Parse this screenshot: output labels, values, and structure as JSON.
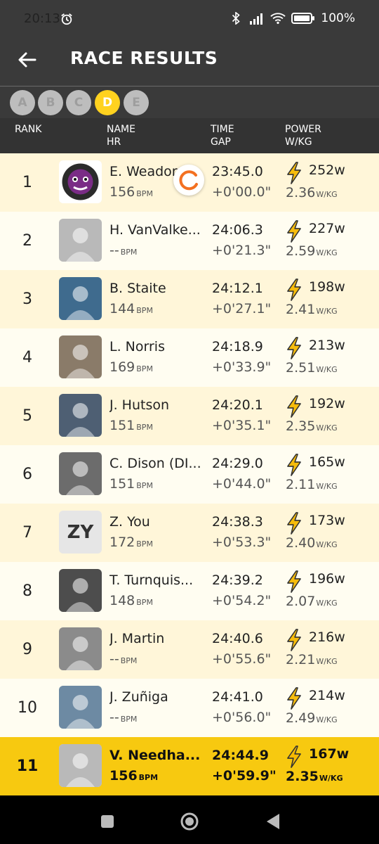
{
  "status": {
    "time": "20:13",
    "battery": "100%"
  },
  "header": {
    "title": "RACE RESULTS"
  },
  "categories": [
    {
      "label": "A",
      "active": false
    },
    {
      "label": "B",
      "active": false
    },
    {
      "label": "C",
      "active": false
    },
    {
      "label": "D",
      "active": true
    },
    {
      "label": "E",
      "active": false
    }
  ],
  "columns": {
    "rank": "RANK",
    "name": "NAME",
    "hr": "HR",
    "time": "TIME",
    "gap": "GAP",
    "power": "POWER",
    "wkg": "W/KG"
  },
  "units": {
    "bpm": "BPM",
    "w": "w",
    "wkg": "W/KG"
  },
  "colors": {
    "accent": "#ffd21f",
    "highlight_row": "#f7c910",
    "bolt": "#f5b800",
    "spinner": "#f37021"
  },
  "results": [
    {
      "rank": "1",
      "name": "E. Weador",
      "hr": "156",
      "time": "23:45.0",
      "gap": "+0'00.0\"",
      "watts": "252",
      "wkg": "2.36",
      "avatar": "gorilla-logo"
    },
    {
      "rank": "2",
      "name": "H. VanValke...",
      "hr": "--",
      "time": "24:06.3",
      "gap": "+0'21.3\"",
      "watts": "227",
      "wkg": "2.59",
      "avatar": "photo"
    },
    {
      "rank": "3",
      "name": "B. Staite",
      "hr": "144",
      "time": "24:12.1",
      "gap": "+0'27.1\"",
      "watts": "198",
      "wkg": "2.41",
      "avatar": "photo"
    },
    {
      "rank": "4",
      "name": "L. Norris",
      "hr": "169",
      "time": "24:18.9",
      "gap": "+0'33.9\"",
      "watts": "213",
      "wkg": "2.51",
      "avatar": "photo"
    },
    {
      "rank": "5",
      "name": "J. Hutson",
      "hr": "151",
      "time": "24:20.1",
      "gap": "+0'35.1\"",
      "watts": "192",
      "wkg": "2.35",
      "avatar": "photo"
    },
    {
      "rank": "6",
      "name": "C. Dison (DI...",
      "hr": "151",
      "time": "24:29.0",
      "gap": "+0'44.0\"",
      "watts": "165",
      "wkg": "2.11",
      "avatar": "photo"
    },
    {
      "rank": "7",
      "name": "Z. You",
      "hr": "172",
      "time": "24:38.3",
      "gap": "+0'53.3\"",
      "watts": "173",
      "wkg": "2.40",
      "avatar": "initials",
      "initials": "ZY"
    },
    {
      "rank": "8",
      "name": "T. Turnquis...",
      "hr": "148",
      "time": "24:39.2",
      "gap": "+0'54.2\"",
      "watts": "196",
      "wkg": "2.07",
      "avatar": "photo"
    },
    {
      "rank": "9",
      "name": "J. Martin",
      "hr": "--",
      "time": "24:40.6",
      "gap": "+0'55.6\"",
      "watts": "216",
      "wkg": "2.21",
      "avatar": "photo"
    },
    {
      "rank": "10",
      "name": "J. Zuñiga",
      "hr": "--",
      "time": "24:41.0",
      "gap": "+0'56.0\"",
      "watts": "214",
      "wkg": "2.49",
      "avatar": "photo"
    },
    {
      "rank": "11",
      "name": "V. Needha...",
      "hr": "156",
      "time": "24:44.9",
      "gap": "+0'59.9\"",
      "watts": "167",
      "wkg": "2.35",
      "avatar": "photo",
      "highlight": true
    }
  ]
}
